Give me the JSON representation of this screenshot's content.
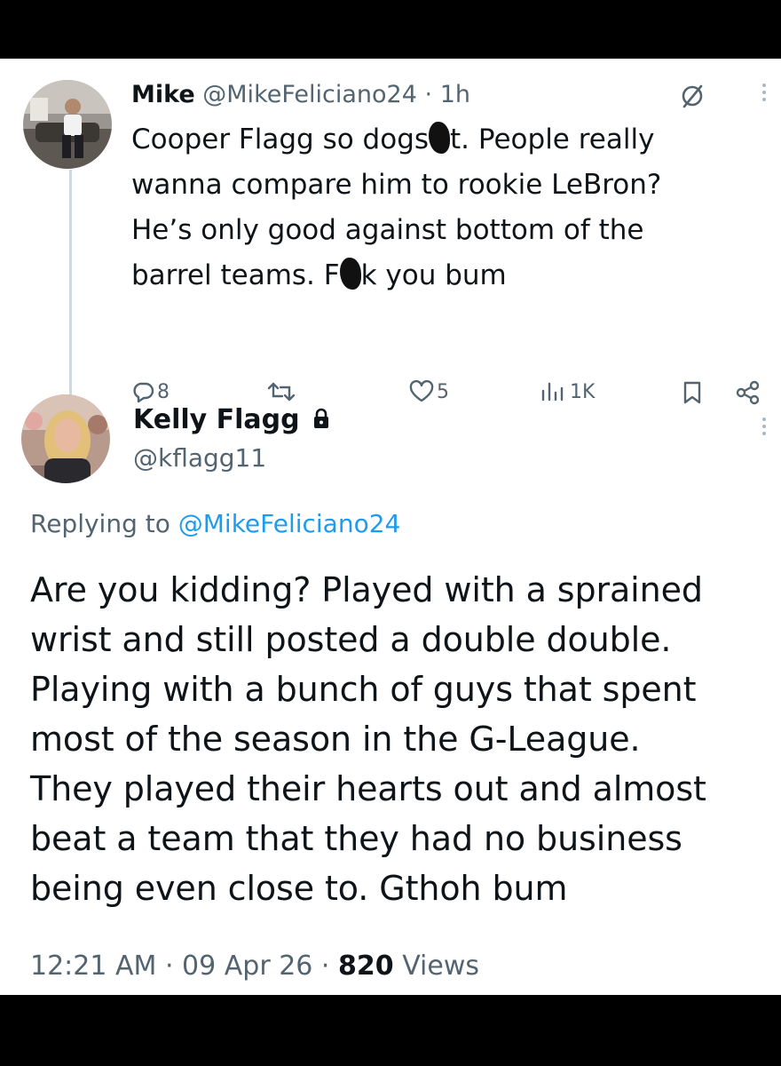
{
  "tweet1": {
    "author_name": "Mike",
    "handle": "@MikeFeliciano24",
    "separator": "·",
    "time": "1h",
    "text_lines": [
      [
        "Cooper Flagg so dogs",
        "t. People really"
      ],
      [
        "wanna compare him to rookie LeBron?"
      ],
      [
        "He’s only good against bottom of the"
      ],
      [
        "barrel teams. F",
        "k you bum"
      ]
    ],
    "actions": {
      "replies": "8",
      "reposts": "",
      "likes": "5",
      "views": "1K"
    },
    "icons": [
      "reply-icon",
      "repost-icon",
      "like-icon",
      "views-icon",
      "bookmark-icon",
      "share-icon",
      "grok-icon",
      "more-icon"
    ]
  },
  "tweet2": {
    "author_name": "Kelly Flagg",
    "handle": "@kflagg11",
    "replying_to_prefix": "Replying to",
    "replying_to_handle": "@MikeFeliciano24",
    "text_lines": [
      "Are you kidding? Played with a sprained",
      "wrist and still posted a double double.",
      "Playing with a bunch of guys that spent",
      "most of the season in the G-League.",
      "They played their hearts out and almost",
      "beat a team that they had no business",
      "being even close to. Gthoh bum"
    ],
    "time": "12:21 AM",
    "date": "09 Apr 26",
    "separator": "·",
    "views_count": "820",
    "views_label": "Views",
    "icons": [
      "lock-icon",
      "more-icon"
    ]
  },
  "colors": {
    "accent": "#1d9bf0",
    "text": "#0f1419",
    "muted": "#536471",
    "frame": "#000000"
  }
}
